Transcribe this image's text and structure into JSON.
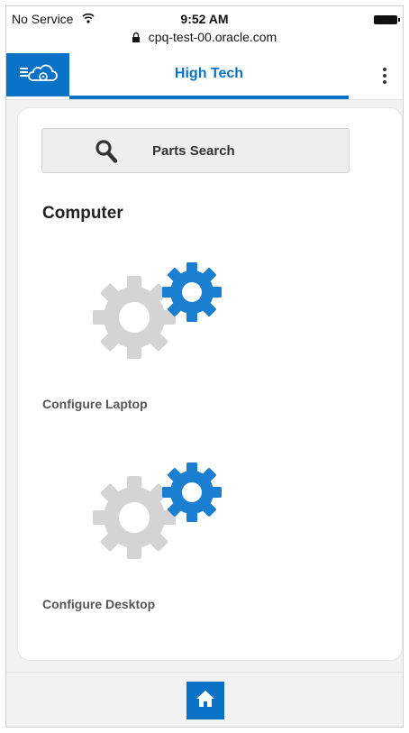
{
  "status_bar": {
    "carrier": "No Service",
    "time": "9:52 AM",
    "url": "cpq-test-00.oracle.com"
  },
  "header": {
    "title": "High Tech"
  },
  "search": {
    "label": "Parts Search"
  },
  "section": {
    "title": "Computer"
  },
  "tiles": [
    {
      "label": "Configure Laptop",
      "icon": "gears-icon"
    },
    {
      "label": "Configure Desktop",
      "icon": "gears-icon"
    }
  ],
  "colors": {
    "accent": "#0a72c6",
    "gear_gray": "#d4d4d4",
    "gear_blue": "#1a7fd0"
  }
}
